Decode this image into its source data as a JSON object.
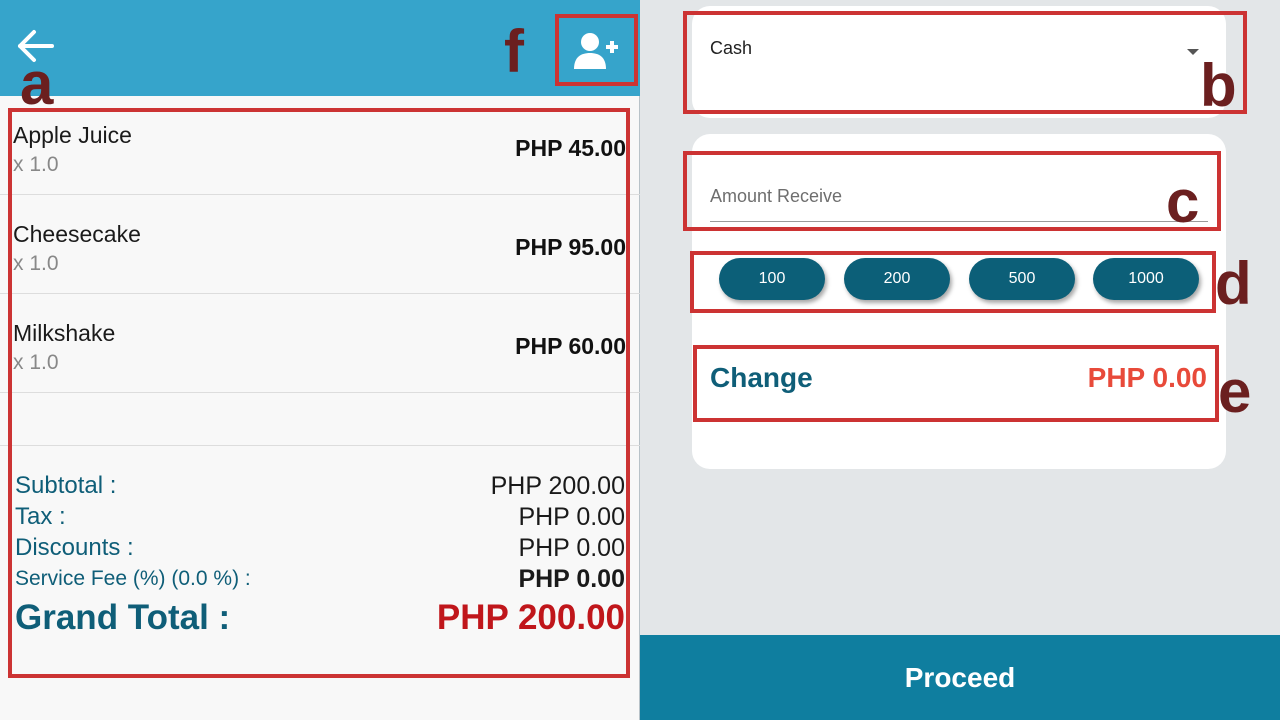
{
  "header": {
    "back_icon": "arrow-left-icon",
    "add_customer_icon": "person-add-icon",
    "bar_color": "#36a4cb"
  },
  "order_items": [
    {
      "name": "Apple Juice",
      "qty": "x 1.0",
      "price": "PHP 45.00"
    },
    {
      "name": "Cheesecake",
      "qty": "x 1.0",
      "price": "PHP 95.00"
    },
    {
      "name": "Milkshake",
      "qty": "x 1.0",
      "price": "PHP 60.00"
    }
  ],
  "totals": {
    "subtotal_label": "Subtotal :",
    "subtotal_value": "PHP 200.00",
    "tax_label": "Tax :",
    "tax_value": "PHP 0.00",
    "discounts_label": "Discounts :",
    "discounts_value": "PHP 0.00",
    "service_fee_label": "Service Fee (%) (0.0 %) :",
    "service_fee_value": "PHP 0.00",
    "grand_total_label": "Grand Total :",
    "grand_total_value": "PHP 200.00"
  },
  "payment": {
    "method_selected": "Cash",
    "amount_placeholder": "Amount Receive",
    "quick_amounts": [
      "100",
      "200",
      "500",
      "1000"
    ],
    "change_label": "Change",
    "change_value": "PHP 0.00",
    "proceed_label": "Proceed"
  },
  "annotations": [
    "a",
    "b",
    "c",
    "d",
    "e",
    "f"
  ],
  "colors": {
    "accent_teal": "#0f5e78",
    "grand_total_red": "#c0161b",
    "change_red": "#e84a3a",
    "annotation_red": "#cc3333",
    "annotation_letter": "#6b1f1f",
    "proceed_bg": "#0f7e9f"
  }
}
